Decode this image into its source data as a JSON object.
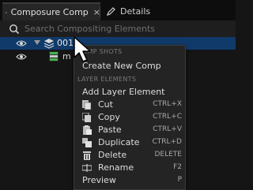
{
  "tabs": [
    {
      "label": "Composure Comp",
      "close": "×"
    },
    {
      "label": "Details"
    }
  ],
  "search": {
    "placeholder": "Search Compositing Elements"
  },
  "tree": {
    "comp_label": "001",
    "element_label": "m"
  },
  "menu": {
    "comp_shots_header": "COMP SHOTS",
    "create_new_comp": "Create New Comp",
    "layer_elements_header": "LAYER ELEMENTS",
    "add_layer_element": "Add Layer Element",
    "items": [
      {
        "label": "Cut",
        "shortcut": "CTRL+X"
      },
      {
        "label": "Copy",
        "shortcut": "CTRL+C"
      },
      {
        "label": "Paste",
        "shortcut": "CTRL+V"
      },
      {
        "label": "Duplicate",
        "shortcut": "CTRL+D"
      },
      {
        "label": "Delete",
        "shortcut": "DELETE"
      },
      {
        "label": "Rename",
        "shortcut": "F2"
      }
    ],
    "preview": {
      "label": "Preview",
      "shortcut": "P"
    }
  },
  "colors": {
    "selection": "#103a6a",
    "menu_bg": "#242424",
    "panel_bg": "#151515"
  }
}
